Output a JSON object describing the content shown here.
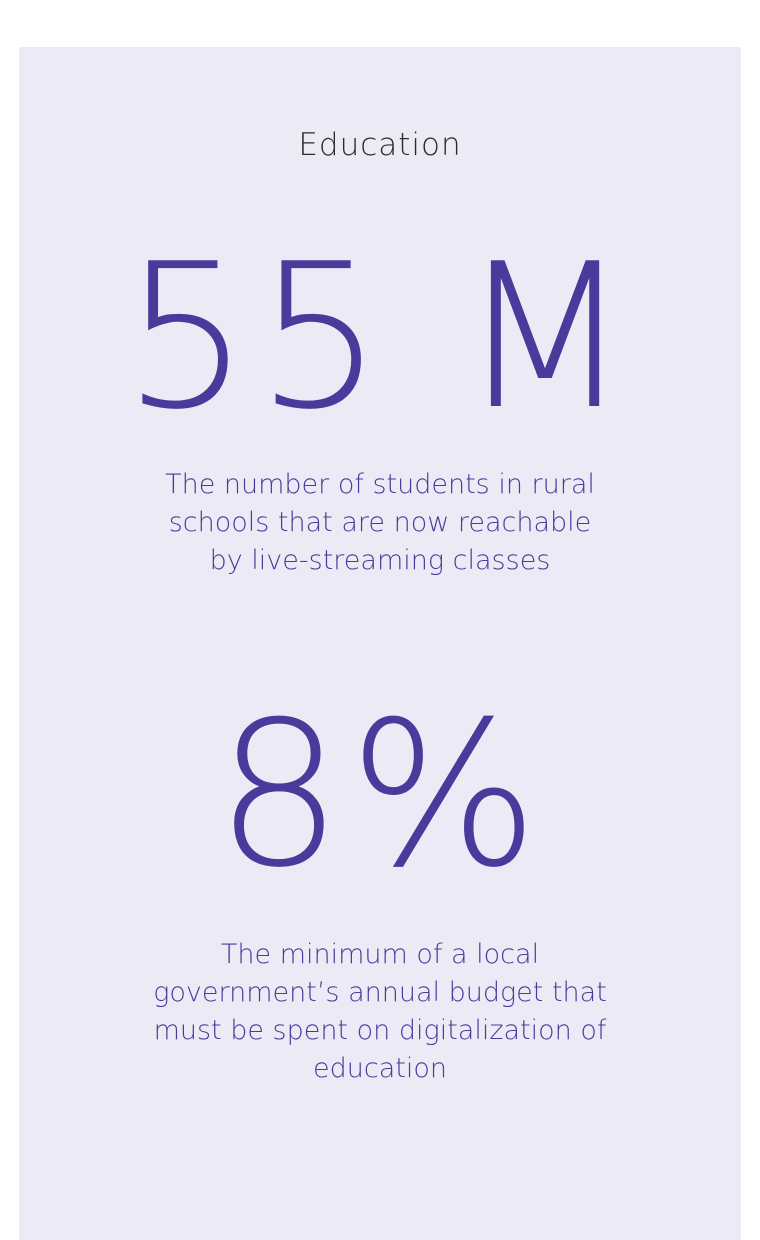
{
  "section": {
    "title": "Education"
  },
  "stats": [
    {
      "value": "55 M",
      "description": "The number of students in rural schools that are now reachable by live-streaming classes"
    },
    {
      "value": "8%",
      "description": "The minimum of a local government’s annual budget that must be spent on digitalization of education"
    }
  ],
  "colors": {
    "accent": "#4b3a9c",
    "card_background": "#ecebf5",
    "title_text": "#2b2b2b"
  }
}
